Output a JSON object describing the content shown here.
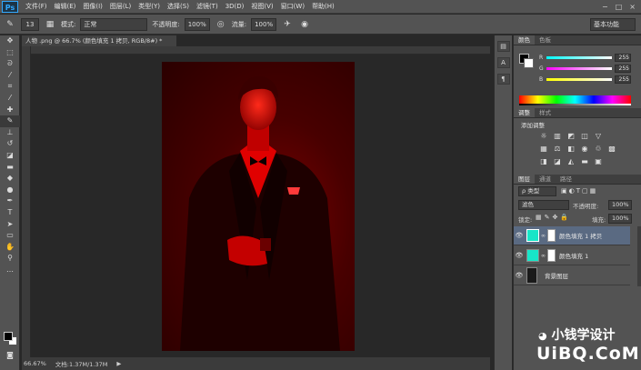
{
  "app": {
    "logo": "Ps"
  },
  "menu": [
    "文件(F)",
    "编辑(E)",
    "图像(I)",
    "图层(L)",
    "类型(Y)",
    "选择(S)",
    "滤镜(T)",
    "3D(D)",
    "视图(V)",
    "窗口(W)",
    "帮助(H)"
  ],
  "window_controls": {
    "minimize": "−",
    "maximize": "□",
    "close": "×"
  },
  "options_bar": {
    "brush_size": "13",
    "mode_label": "模式:",
    "mode_value": "正常",
    "opacity_label": "不透明度:",
    "opacity_value": "100%",
    "flow_label": "流量:",
    "flow_value": "100%",
    "workspace": "基本功能"
  },
  "document": {
    "tab_title": "人物 .png @ 66.7% (颜色填充 1 拷贝, RGB/8#) *",
    "zoom": "66.67%",
    "doc_size": "文档:1.37M/1.37M"
  },
  "color_panel": {
    "tabs": [
      "颜色",
      "色板"
    ],
    "r_label": "R",
    "r_value": "255",
    "g_label": "G",
    "g_value": "255",
    "b_label": "B",
    "b_value": "255"
  },
  "adjust_panel": {
    "tabs": [
      "调整",
      "样式"
    ],
    "add_label": "添加调整"
  },
  "layers_panel": {
    "tabs": [
      "图层",
      "通道",
      "路径"
    ],
    "kind_filter": "ρ 类型",
    "blend_mode": "滤色",
    "opacity_label": "不透明度:",
    "opacity_value": "100%",
    "lock_label": "锁定:",
    "fill_label": "填充:",
    "fill_value": "100%",
    "layers": [
      {
        "name": "颜色填充 1 拷贝",
        "selected": true
      },
      {
        "name": "颜色填充 1",
        "selected": false
      },
      {
        "name": "背景图层",
        "selected": false
      }
    ]
  },
  "watermark": {
    "line1": "小钱学设计",
    "line2": "UiBQ.CoM"
  },
  "colors": {
    "fill_thumb": "#17e6c8",
    "selected_layer": "#5a6a82",
    "photo_red": "#e00000"
  }
}
